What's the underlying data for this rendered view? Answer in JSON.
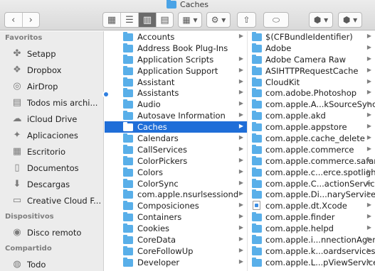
{
  "window": {
    "title": "Caches"
  },
  "toolbar": {
    "back": "‹",
    "forward": "›",
    "view_icons": "▦",
    "view_list": "☰",
    "view_columns": "▥",
    "view_gallery": "▤",
    "group": "▦ ▾",
    "action": "⚙ ▾",
    "share": "⇧",
    "tag": "⬭",
    "dropbox": "⬢ ▾",
    "search": "⬢ ▾"
  },
  "sidebar": {
    "favorites_label": "Favoritos",
    "favorites": [
      {
        "label": "Setapp",
        "icon": "setapp-icon",
        "glyph": "✤"
      },
      {
        "label": "Dropbox",
        "icon": "dropbox-icon",
        "glyph": "❖"
      },
      {
        "label": "AirDrop",
        "icon": "airdrop-icon",
        "glyph": "◎"
      },
      {
        "label": "Todos mis archi...",
        "icon": "all-files-icon",
        "glyph": "▤"
      },
      {
        "label": "iCloud Drive",
        "icon": "cloud-icon",
        "glyph": "☁"
      },
      {
        "label": "Aplicaciones",
        "icon": "applications-icon",
        "glyph": "✦"
      },
      {
        "label": "Escritorio",
        "icon": "desktop-icon",
        "glyph": "▦"
      },
      {
        "label": "Documentos",
        "icon": "documents-icon",
        "glyph": "▯"
      },
      {
        "label": "Descargas",
        "icon": "downloads-icon",
        "glyph": "⬇"
      },
      {
        "label": "Creative Cloud F...",
        "icon": "folder-icon",
        "glyph": "▭"
      }
    ],
    "devices_label": "Dispositivos",
    "devices": [
      {
        "label": "Disco remoto",
        "icon": "remote-disk-icon",
        "glyph": "◉"
      }
    ],
    "shared_label": "Compartido",
    "shared": [
      {
        "label": "Todo",
        "icon": "network-icon",
        "glyph": "◍"
      }
    ]
  },
  "column1": [
    {
      "label": "Accounts",
      "has_children": true
    },
    {
      "label": "Address Book Plug-Ins",
      "has_children": false
    },
    {
      "label": "Application Scripts",
      "has_children": true
    },
    {
      "label": "Application Support",
      "has_children": true
    },
    {
      "label": "Assistant",
      "has_children": true
    },
    {
      "label": "Assistants",
      "has_children": true
    },
    {
      "label": "Audio",
      "has_children": true
    },
    {
      "label": "Autosave Information",
      "has_children": true
    },
    {
      "label": "Caches",
      "has_children": true,
      "selected": true
    },
    {
      "label": "Calendars",
      "has_children": true
    },
    {
      "label": "CallServices",
      "has_children": true
    },
    {
      "label": "ColorPickers",
      "has_children": true
    },
    {
      "label": "Colors",
      "has_children": true
    },
    {
      "label": "ColorSync",
      "has_children": true
    },
    {
      "label": "com.apple.nsurlsessiond",
      "has_children": true
    },
    {
      "label": "Composiciones",
      "has_children": true
    },
    {
      "label": "Containers",
      "has_children": true
    },
    {
      "label": "Cookies",
      "has_children": true
    },
    {
      "label": "CoreData",
      "has_children": true
    },
    {
      "label": "CoreFollowUp",
      "has_children": true
    },
    {
      "label": "Developer",
      "has_children": true
    }
  ],
  "column2": [
    {
      "label": "$(CFBundleIdentifier)",
      "has_children": true
    },
    {
      "label": "Adobe",
      "has_children": true
    },
    {
      "label": "Adobe Camera Raw",
      "has_children": true
    },
    {
      "label": "ASIHTTPRequestCache",
      "has_children": true
    },
    {
      "label": "CloudKit",
      "has_children": true
    },
    {
      "label": "com.adobe.Photoshop",
      "has_children": true
    },
    {
      "label": "com.apple.A...kSourceSync",
      "has_children": true
    },
    {
      "label": "com.apple.akd",
      "has_children": true
    },
    {
      "label": "com.apple.appstore",
      "has_children": true
    },
    {
      "label": "com.apple.cache_delete",
      "has_children": true
    },
    {
      "label": "com.apple.commerce",
      "has_children": true
    },
    {
      "label": "com.apple.commerce.safari",
      "has_children": true
    },
    {
      "label": "com.apple.c...erce.spotlight",
      "has_children": true
    },
    {
      "label": "com.apple.C...actionService",
      "has_children": true
    },
    {
      "label": "com.apple.Di...naryServices",
      "has_children": true
    },
    {
      "label": "com.apple.dt.Xcode",
      "has_children": true,
      "file": true
    },
    {
      "label": "com.apple.finder",
      "has_children": true
    },
    {
      "label": "com.apple.helpd",
      "has_children": true
    },
    {
      "label": "com.apple.i...nnectionAgent",
      "has_children": true
    },
    {
      "label": "com.apple.k...oardservicesd",
      "has_children": true
    },
    {
      "label": "com.apple.L...pViewService",
      "has_children": true
    }
  ]
}
